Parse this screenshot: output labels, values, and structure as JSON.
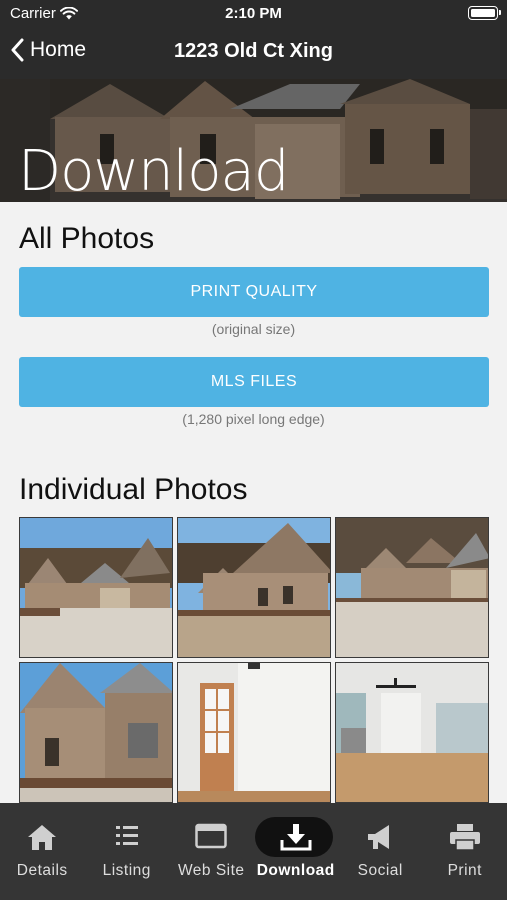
{
  "status": {
    "carrier": "Carrier",
    "time": "2:10 PM"
  },
  "nav": {
    "back_label": "Home",
    "title": "1223 Old Ct Xing"
  },
  "hero": {
    "title": "Download"
  },
  "all_photos": {
    "heading": "All Photos",
    "print_quality": {
      "label": "PRINT QUALITY",
      "caption": "(original size)"
    },
    "mls_files": {
      "label": "MLS FILES",
      "caption": "(1,280 pixel long edge)"
    }
  },
  "individual": {
    "heading": "Individual Photos"
  },
  "tabs": [
    {
      "label": "Details",
      "icon": "house-icon"
    },
    {
      "label": "Listing",
      "icon": "list-icon"
    },
    {
      "label": "Web Site",
      "icon": "browser-icon"
    },
    {
      "label": "Download",
      "icon": "download-icon"
    },
    {
      "label": "Social",
      "icon": "megaphone-icon"
    },
    {
      "label": "Print",
      "icon": "printer-icon"
    }
  ],
  "colors": {
    "accent": "#4fb3e3",
    "bar": "#2b2b2b",
    "tabbar": "#353535"
  }
}
